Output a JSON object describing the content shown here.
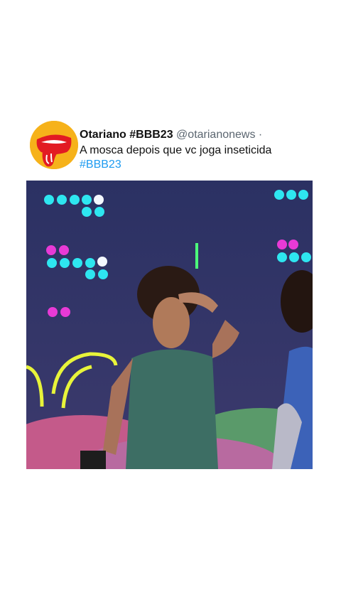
{
  "tweet": {
    "display_name": "Otariano #BBB23",
    "handle": "@otarianonews",
    "separator": "·",
    "text": "A mosca depois que vc joga inseticida",
    "hashtag": "#BBB23"
  },
  "avatar": {
    "icon": "tongue-logo-icon",
    "background": "#f6b21a",
    "lips": "#e21b23"
  },
  "media": {
    "description_icon": "video-frame"
  },
  "colors": {
    "hashtag": "#1d9bf0",
    "handle": "#5b6670"
  }
}
